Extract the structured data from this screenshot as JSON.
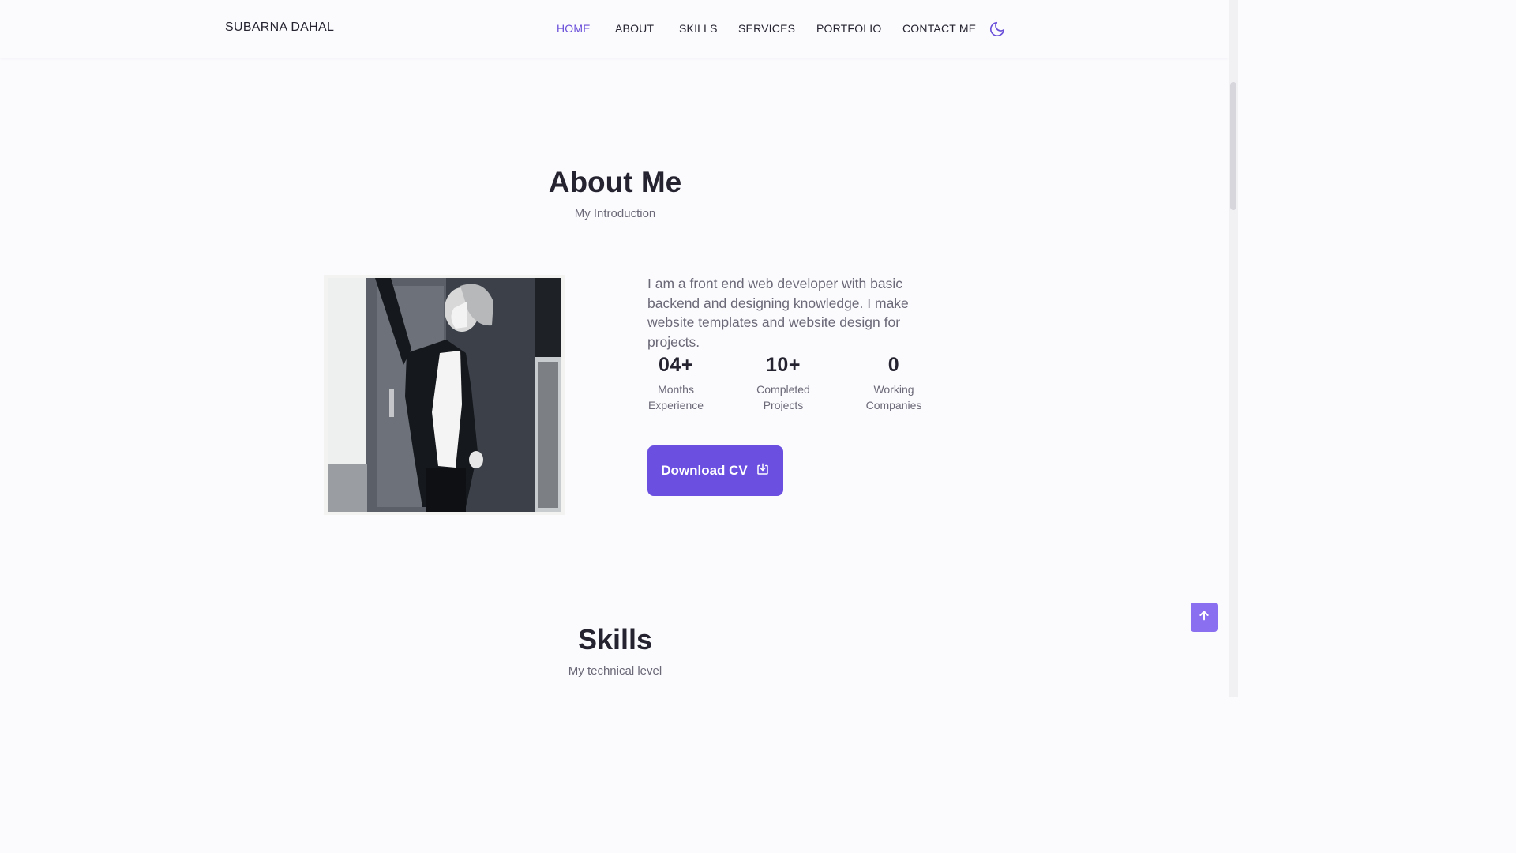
{
  "header": {
    "brand": "SUBARNA DAHAL",
    "nav": [
      "HOME",
      "ABOUT",
      "SKILLS",
      "SERVICES",
      "PORTFOLIO",
      "CONTACT ME"
    ],
    "active_nav": "HOME",
    "theme_icon": "moon-icon"
  },
  "about": {
    "title": "About Me",
    "subtitle": "My Introduction",
    "description": "I am a front end web developer with basic backend and designing knowledge. I make website templates and website design for projects.",
    "stats": [
      {
        "number": "04+",
        "label_line1": "Months",
        "label_line2": "Experience"
      },
      {
        "number": "10+",
        "label_line1": "Completed",
        "label_line2": "Projects"
      },
      {
        "number": "0",
        "label_line1": "Working",
        "label_line2": "Companies"
      }
    ],
    "download_label": "Download CV",
    "download_icon": "download-icon",
    "photo_icon": "profile-photo"
  },
  "skills": {
    "title": "Skills",
    "subtitle": "My technical level"
  },
  "scroll_up_icon": "arrow-up-icon",
  "colors": {
    "accent": "#6b4fe0",
    "accent_light": "#8a6ff0",
    "active_nav": "#6a4fd9",
    "text": "#25232f",
    "muted": "#6b6977",
    "background": "#fbfbfe"
  }
}
